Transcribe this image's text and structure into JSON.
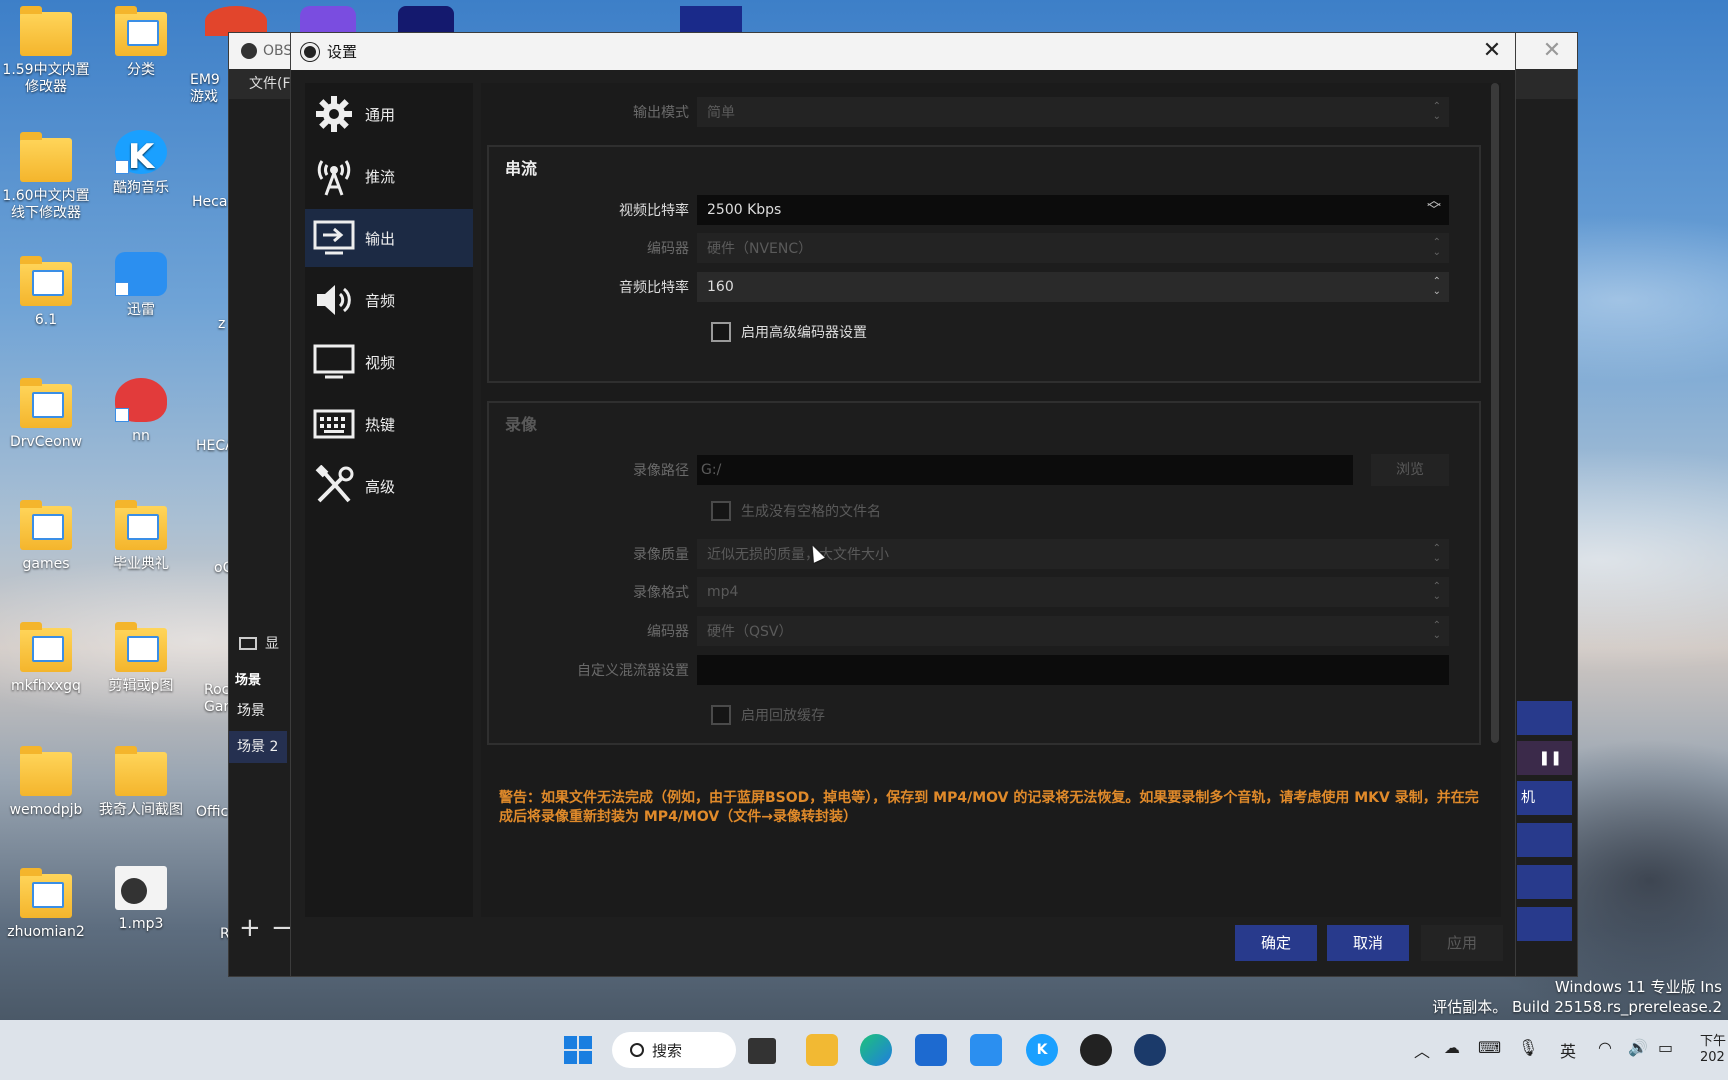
{
  "desktop_icons": [
    {
      "label": "1.59中文内置修改器",
      "type": "folder"
    },
    {
      "label": "分类",
      "type": "folder-doc"
    },
    {
      "label": "EM9 游戏",
      "type": "app"
    },
    {
      "label": "1.60中文内置线下修改器",
      "type": "folder"
    },
    {
      "label": "酷狗音乐",
      "type": "app-k"
    },
    {
      "label": "Heca",
      "type": "folder"
    },
    {
      "label": "6.1",
      "type": "folder"
    },
    {
      "label": "迅雷",
      "type": "app-bird"
    },
    {
      "label": "z",
      "type": "folder"
    },
    {
      "label": "DrvCeonw",
      "type": "folder-doc"
    },
    {
      "label": "nn",
      "type": "app-heart"
    },
    {
      "label": "HECA",
      "type": "app"
    },
    {
      "label": "games",
      "type": "folder-doc"
    },
    {
      "label": "毕业典礼",
      "type": "folder"
    },
    {
      "label": "oC",
      "type": "app"
    },
    {
      "label": "mkfhxxgq",
      "type": "folder-doc"
    },
    {
      "label": "剪辑或p图",
      "type": "folder-doc"
    },
    {
      "label": "Roc Gar",
      "type": "app"
    },
    {
      "label": "wemodpjb",
      "type": "folder"
    },
    {
      "label": "我奇人间截图",
      "type": "folder"
    },
    {
      "label": "Offic",
      "type": "folder"
    },
    {
      "label": "zhuomian2",
      "type": "folder-doc"
    },
    {
      "label": "1.mp3",
      "type": "app-mp3"
    },
    {
      "label": "R",
      "type": "app"
    }
  ],
  "obs_main": {
    "title": "OBS",
    "menu_file": "文件(F",
    "scenes_dock_label": "显",
    "scenes_tab": "场景",
    "scenes": [
      "场景",
      "场景 2"
    ],
    "right_label": "机",
    "pause_icon": "pause-icon"
  },
  "dialog": {
    "title": "设置",
    "close_glyph": "✕",
    "sidebar": [
      {
        "label": "通用",
        "icon": "gear-icon"
      },
      {
        "label": "推流",
        "icon": "antenna-icon"
      },
      {
        "label": "输出",
        "icon": "output-icon",
        "selected": true
      },
      {
        "label": "音频",
        "icon": "speaker-icon"
      },
      {
        "label": "视频",
        "icon": "monitor-icon"
      },
      {
        "label": "热键",
        "icon": "keyboard-icon"
      },
      {
        "label": "高级",
        "icon": "tools-icon"
      }
    ],
    "output_mode": {
      "label": "输出模式",
      "value": "简单"
    },
    "streaming": {
      "title": "串流",
      "video_bitrate": {
        "label": "视频比特率",
        "value": "2500 Kbps"
      },
      "encoder": {
        "label": "编码器",
        "value": "硬件（NVENC）"
      },
      "audio_bitrate": {
        "label": "音频比特率",
        "value": "160"
      },
      "advanced_encoder": {
        "label": "启用高级编码器设置",
        "checked": false
      }
    },
    "recording": {
      "title": "录像",
      "path": {
        "label": "录像路径",
        "value": "G:/"
      },
      "browse": "浏览",
      "no_space": {
        "label": "生成没有空格的文件名",
        "checked": false
      },
      "quality": {
        "label": "录像质量",
        "value": "近似无损的质量，大文件大小"
      },
      "format": {
        "label": "录像格式",
        "value": "mp4"
      },
      "encoder": {
        "label": "编码器",
        "value": "硬件（QSV）"
      },
      "muxer": {
        "label": "自定义混流器设置",
        "value": ""
      },
      "replay_buffer": {
        "label": "启用回放缓存",
        "checked": false
      }
    },
    "warning": "警告：如果文件无法完成（例如，由于蓝屏BSOD，掉电等），保存到 MP4/MOV 的记录将无法恢复。如果要录制多个音轨，请考虑使用 MKV 录制，并在完成后将录像重新封装为 MP4/MOV（文件→录像转封装）",
    "buttons": {
      "ok": "确定",
      "cancel": "取消",
      "apply": "应用"
    }
  },
  "taskbar": {
    "search": "搜索",
    "ime": "英",
    "clock_top": "下午",
    "clock_bottom": "202"
  },
  "watermark": {
    "line1": "Windows 11 专业版 Ins",
    "line2": "评估副本。 Build 25158.rs_prerelease.2"
  },
  "colors": {
    "accent_button": "#283a8c",
    "sidebar_selected": "#1c2a44",
    "warning": "#e08a2a"
  }
}
